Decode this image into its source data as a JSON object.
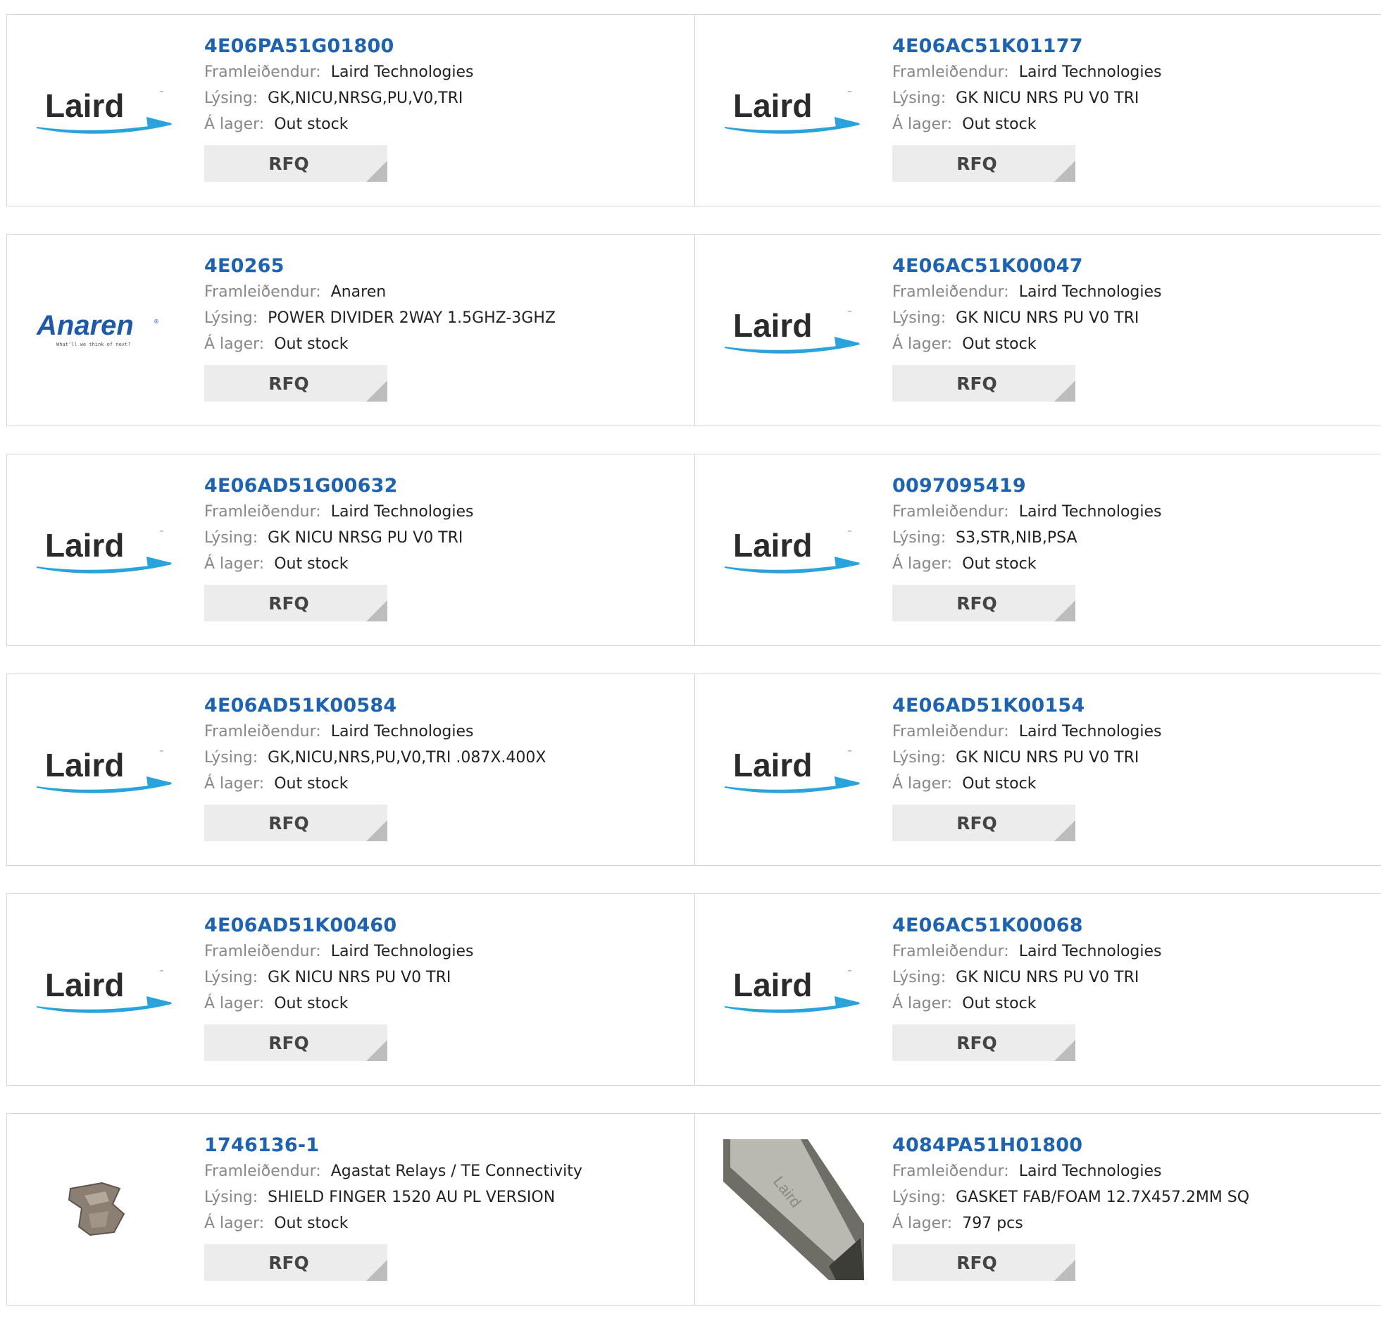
{
  "labels": {
    "manufacturer": "Framleiðendur:",
    "description": "Lýsing:",
    "stock": "Á lager:",
    "rfq": "RFQ"
  },
  "brand_colors": {
    "laird_text": "#2b2b2b",
    "laird_swoosh": "#29a3dc",
    "anaren": "#1e5aa8",
    "part_link": "#1e63b0"
  },
  "rows": [
    {
      "left": {
        "part": "4E06PA51G01800",
        "manufacturer": "Laird Technologies",
        "description": "GK,NICU,NRSG,PU,V0,TRI",
        "stock": "Out stock",
        "logo": "Laird"
      },
      "right": {
        "part": "4E06AC51K01177",
        "manufacturer": "Laird Technologies",
        "description": "GK NICU NRS PU V0 TRI",
        "stock": "Out stock",
        "logo": "Laird"
      }
    },
    {
      "left": {
        "part": "4E0265",
        "manufacturer": "Anaren",
        "description": "POWER DIVIDER 2WAY 1.5GHZ-3GHZ",
        "stock": "Out stock",
        "logo": "Anaren",
        "tagline": "What'll we think of next?"
      },
      "right": {
        "part": "4E06AC51K00047",
        "manufacturer": "Laird Technologies",
        "description": "GK NICU NRS PU V0 TRI",
        "stock": "Out stock",
        "logo": "Laird"
      }
    },
    {
      "left": {
        "part": "4E06AD51G00632",
        "manufacturer": "Laird Technologies",
        "description": "GK NICU NRSG PU V0 TRI",
        "stock": "Out stock",
        "logo": "Laird"
      },
      "right": {
        "part": "0097095419",
        "manufacturer": "Laird Technologies",
        "description": "S3,STR,NIB,PSA",
        "stock": "Out stock",
        "logo": "Laird"
      }
    },
    {
      "left": {
        "part": "4E06AD51K00584",
        "manufacturer": "Laird Technologies",
        "description": "GK,NICU,NRS,PU,V0,TRI .087X.400X",
        "stock": "Out stock",
        "logo": "Laird"
      },
      "right": {
        "part": "4E06AD51K00154",
        "manufacturer": "Laird Technologies",
        "description": "GK NICU NRS PU V0 TRI",
        "stock": "Out stock",
        "logo": "Laird"
      }
    },
    {
      "left": {
        "part": "4E06AD51K00460",
        "manufacturer": "Laird Technologies",
        "description": "GK NICU NRS PU V0 TRI",
        "stock": "Out stock",
        "logo": "Laird"
      },
      "right": {
        "part": "4E06AC51K00068",
        "manufacturer": "Laird Technologies",
        "description": "GK NICU NRS PU V0 TRI",
        "stock": "Out stock",
        "logo": "Laird"
      }
    },
    {
      "left": {
        "part": "1746136-1",
        "manufacturer": "Agastat Relays / TE Connectivity",
        "description": "SHIELD FINGER 1520 AU PL VERSION",
        "stock": "Out stock",
        "logo": "shield-finger-photo"
      },
      "right": {
        "part": "4084PA51H01800",
        "manufacturer": "Laird Technologies",
        "description": "GASKET FAB/FOAM 12.7X457.2MM SQ",
        "stock": "797 pcs",
        "logo": "gasket-photo",
        "watermark": "Laird"
      }
    }
  ]
}
